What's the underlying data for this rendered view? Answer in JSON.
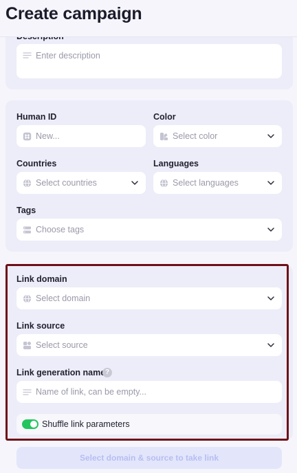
{
  "header": {
    "title": "Create campaign"
  },
  "description": {
    "label": "Description",
    "placeholder": "Enter description"
  },
  "main": {
    "human_id": {
      "label": "Human ID",
      "placeholder": "New..."
    },
    "color": {
      "label": "Color",
      "placeholder": "Select color"
    },
    "countries": {
      "label": "Countries",
      "placeholder": "Select countries"
    },
    "languages": {
      "label": "Languages",
      "placeholder": "Select languages"
    },
    "tags": {
      "label": "Tags",
      "placeholder": "Choose tags"
    }
  },
  "link": {
    "domain": {
      "label": "Link domain",
      "placeholder": "Select domain"
    },
    "source": {
      "label": "Link source",
      "placeholder": "Select source"
    },
    "generation_name": {
      "label": "Link generation name",
      "placeholder": "Name of link, can be empty...",
      "help": "?"
    },
    "shuffle": {
      "label": "Shuffle link parameters",
      "enabled": true
    },
    "take_link_button": "Select domain & source to take link"
  },
  "colors": {
    "accent": "#6e0f18",
    "toggle_on": "#22c55e",
    "button_disabled_text": "#b7bdf2"
  }
}
